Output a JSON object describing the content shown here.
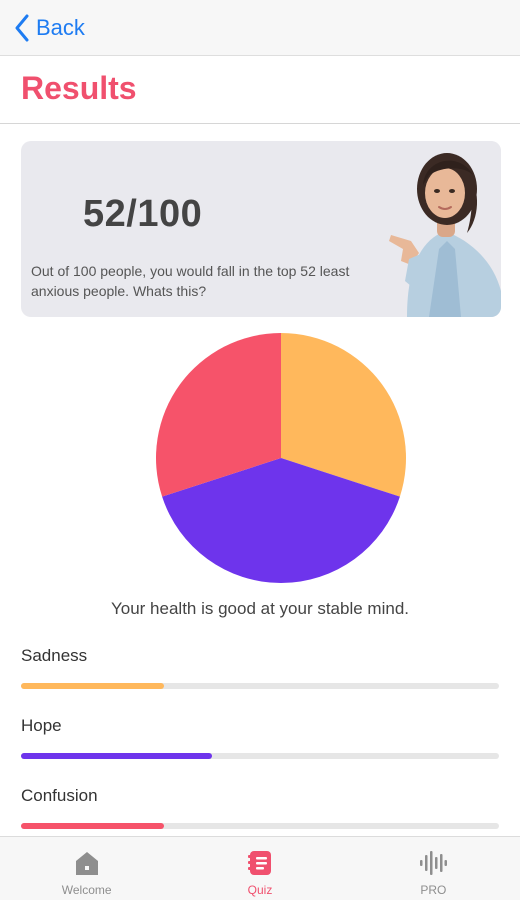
{
  "nav": {
    "back_label": "Back"
  },
  "page": {
    "title": "Results"
  },
  "score_card": {
    "score": "52/100",
    "description": "Out of 100 people, you would fall in the top 52 least anxious people. Whats this?"
  },
  "chart_data": {
    "type": "pie",
    "categories": [
      "Sadness",
      "Hope",
      "Confusion"
    ],
    "values": [
      30,
      40,
      30
    ],
    "colors": [
      "#ffb85c",
      "#6e34ec",
      "#f6536a"
    ]
  },
  "pie_caption": "Your health is good at your stable mind.",
  "metrics": [
    {
      "label": "Sadness",
      "value": 0.3,
      "color": "#ffb85c"
    },
    {
      "label": "Hope",
      "value": 0.4,
      "color": "#6e34ec"
    },
    {
      "label": "Confusion",
      "value": 0.3,
      "color": "#f6536a"
    }
  ],
  "tabs": [
    {
      "label": "Welcome",
      "icon": "home-icon",
      "active": false
    },
    {
      "label": "Quiz",
      "icon": "quiz-icon",
      "active": true
    },
    {
      "label": "PRO",
      "icon": "audio-wave-icon",
      "active": false
    }
  ],
  "colors": {
    "accent": "#f0506e",
    "link": "#1e7cf2",
    "inactive": "#8e8e8e"
  }
}
